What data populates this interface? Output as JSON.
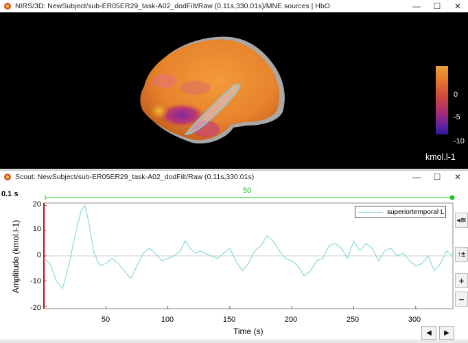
{
  "window3d": {
    "title": "NIRS/3D: NewSubject/sub-ER05ER29_task-A02_dodFilt/Raw (0.11s,330.01s)/MNE sources  | HbO",
    "controls": [
      "—",
      "☐",
      "✕"
    ]
  },
  "colorbar": {
    "ticks": [
      "0",
      "-5",
      "-10"
    ],
    "unit": "kmol.l-1"
  },
  "scout": {
    "title": "Scout: NewSubject/sub-ER05ER29_task-A02_dodFilt/Raw (0.11s,330.01s)",
    "controls": [
      "—",
      "☐",
      "✕"
    ],
    "current_time": "0.1 s",
    "slider_value": "50",
    "side_buttons": [
      "◂≋",
      "↑±",
      "+",
      "−"
    ],
    "nav_prev": "◀",
    "nav_next": "▶"
  },
  "chart_data": {
    "type": "line",
    "xlabel": "Time (s)",
    "ylabel": "Amplitude (kmol.l-1)",
    "xlim": [
      0,
      330
    ],
    "ylim": [
      -21,
      21
    ],
    "xticks": [
      50,
      100,
      150,
      200,
      250,
      300
    ],
    "yticks": [
      20,
      10,
      0,
      -10,
      -20
    ],
    "legend": "top-right",
    "series": [
      {
        "name": "superiortemporal L",
        "color": "#8ad8d8",
        "x": [
          0,
          5,
          10,
          15,
          20,
          25,
          30,
          33,
          36,
          40,
          45,
          50,
          55,
          60,
          65,
          70,
          75,
          80,
          85,
          90,
          95,
          100,
          105,
          110,
          114,
          118,
          122,
          126,
          130,
          135,
          140,
          145,
          150,
          155,
          160,
          165,
          170,
          175,
          180,
          185,
          190,
          195,
          200,
          205,
          210,
          215,
          220,
          225,
          230,
          235,
          240,
          245,
          250,
          255,
          260,
          265,
          270,
          275,
          280,
          285,
          290,
          295,
          300,
          305,
          310,
          315,
          320,
          325,
          330
        ],
        "y": [
          -1,
          -3,
          -10,
          -13,
          -4,
          8,
          18,
          20,
          14,
          2,
          -4,
          -3,
          -1,
          -3,
          -6,
          -9,
          -4,
          1,
          3,
          1,
          -2,
          -1,
          0,
          2,
          6,
          3,
          1,
          2,
          1,
          0,
          -1,
          1,
          3,
          -2,
          -6,
          -3,
          2,
          4,
          8,
          6,
          2,
          -1,
          -2,
          -4,
          -8,
          -6,
          -2,
          -1,
          4,
          5,
          3,
          -1,
          6,
          2,
          5,
          3,
          -2,
          2,
          3,
          0,
          1,
          -2,
          -4,
          -3,
          0,
          -6,
          -3,
          2,
          0
        ]
      }
    ]
  }
}
